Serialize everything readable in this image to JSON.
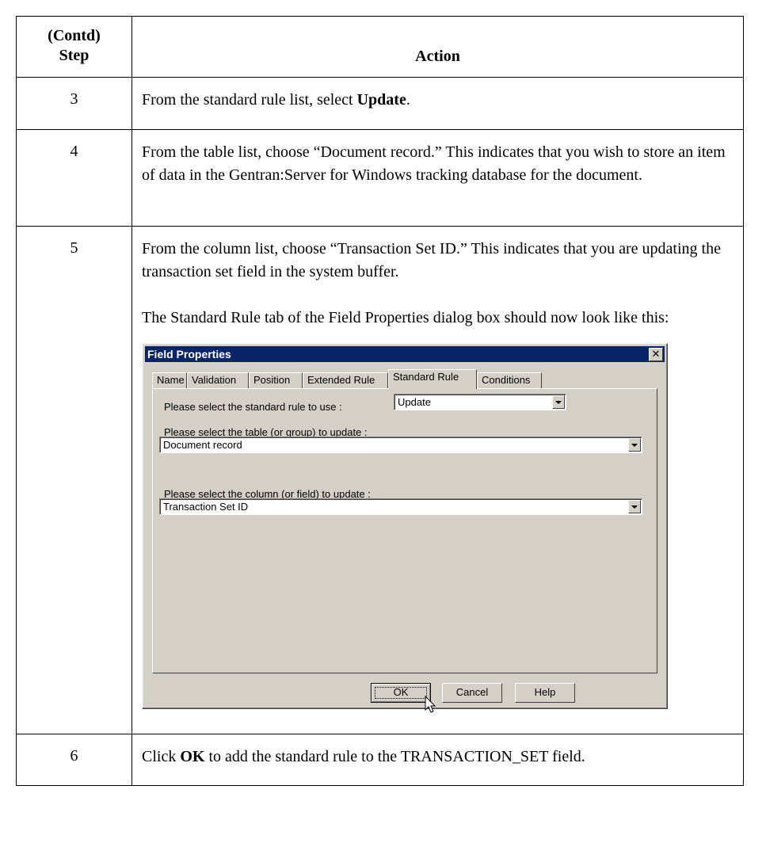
{
  "table": {
    "header_step_line1": "(Contd)",
    "header_step_line2": "Step",
    "header_action": "Action"
  },
  "rows": [
    {
      "step": "3",
      "parts": [
        "From the standard rule list, select ",
        "Update",
        "."
      ]
    },
    {
      "step": "4",
      "text": "From the table list, choose “Document record.” This indicates that you wish to store an item of data in the Gentran:Server for Windows tracking database for the document."
    },
    {
      "step": "5",
      "para1": "From the column list, choose “Transaction Set ID.” This indicates that you are updating the transaction set field in the system buffer.",
      "para2": "The Standard Rule tab of the Field Properties dialog box should now look like this:"
    },
    {
      "step": "6",
      "parts": [
        "Click ",
        "OK",
        " to add the standard rule to the TRANSACTION_SET field."
      ]
    }
  ],
  "dialog": {
    "title": "Field Properties",
    "close_glyph": "✕",
    "tabs": [
      "Name",
      "Validation",
      "Position",
      "Extended Rule",
      "Standard Rule",
      "Conditions"
    ],
    "active_tab": "Standard Rule",
    "rule_label": "Please select the standard rule to use :",
    "rule_value": "Update",
    "table_label": "Please select the table (or group) to update :",
    "table_value": "Document record",
    "column_label": "Please select the column (or field) to update :",
    "column_value": "Transaction Set ID",
    "ok_label": "OK",
    "cancel_label": "Cancel",
    "help_label": "Help"
  }
}
